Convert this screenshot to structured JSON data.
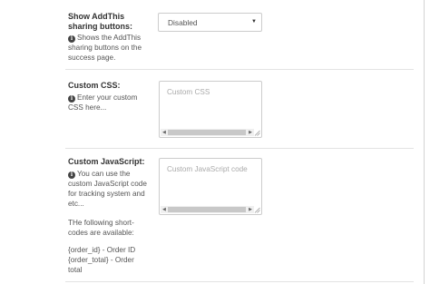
{
  "addthis": {
    "label": "Show AddThis sharing buttons:",
    "description": "Shows the AddThis sharing buttons on the success page.",
    "selected": "Disabled"
  },
  "custom_css": {
    "label": "Custom CSS:",
    "description": "Enter your custom CSS here...",
    "placeholder": "Custom CSS"
  },
  "custom_js": {
    "label": "Custom JavaScript:",
    "description": "You can use the custom JavaScript code for tracking system and etc...",
    "shortcodes_intro": "THe following short-codes are available:",
    "shortcode_order_id": "{order_id} - Order ID",
    "shortcode_order_total": "{order_total} - Order total",
    "placeholder": "Custom JavaScript code"
  },
  "icons": {
    "info": "info-circle-icon",
    "select_caret": "caret-down-icon",
    "scroll_left": "scroll-left-arrow-icon",
    "scroll_right": "scroll-right-arrow-icon",
    "resize": "resize-grip-icon"
  }
}
